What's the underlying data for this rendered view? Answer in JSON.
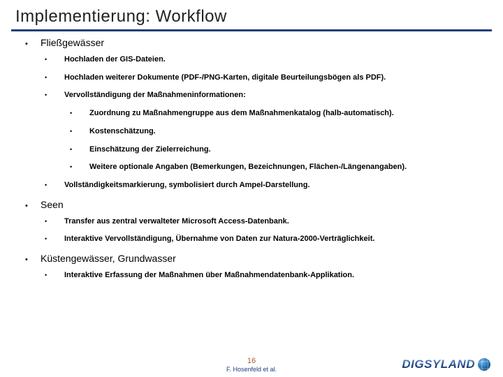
{
  "title": "Implementierung: Workflow",
  "sections": [
    {
      "heading": "Fließgewässer",
      "items": [
        {
          "text": "Hochladen der GIS-Dateien."
        },
        {
          "text": "Hochladen weiterer Dokumente (PDF-/PNG-Karten, digitale Beurteilungsbögen als PDF)."
        },
        {
          "text": "Vervollständigung der Maßnahmeninformationen:",
          "sub": [
            "Zuordnung zu Maßnahmengruppe aus dem Maßnahmenkatalog (halb-automatisch).",
            "Kostenschätzung.",
            "Einschätzung der Zielerreichung.",
            "Weitere optionale Angaben (Bemerkungen, Bezeichnungen, Flächen-/Längenangaben)."
          ]
        },
        {
          "text": "Vollständigkeitsmarkierung, symbolisiert durch Ampel-Darstellung."
        }
      ]
    },
    {
      "heading": "Seen",
      "items": [
        {
          "text": "Transfer aus zentral verwalteter Microsoft Access-Datenbank."
        },
        {
          "text": "Interaktive Vervollständigung, Übernahme von Daten zur Natura-2000-Verträglichkeit."
        }
      ]
    },
    {
      "heading": "Küstengewässer, Grundwasser",
      "items": [
        {
          "text": "Interaktive Erfassung der Maßnahmen über Maßnahmendatenbank-Applikation."
        }
      ]
    }
  ],
  "footer": {
    "page": "16",
    "author": "F. Hosenfeld et al."
  },
  "logo": "DIGSYLAND"
}
